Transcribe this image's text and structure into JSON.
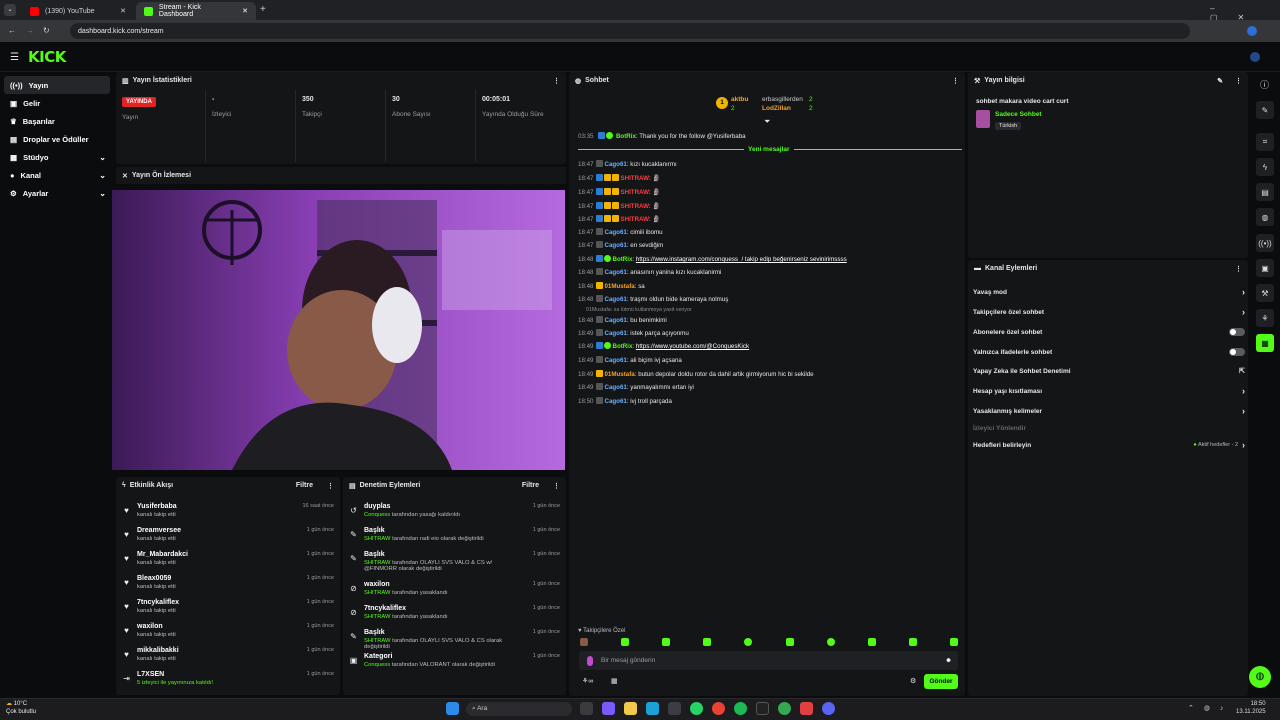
{
  "browser": {
    "tabs": [
      {
        "title": "(1390) YouTube"
      },
      {
        "title": "Stream - Kick Dashboard"
      }
    ],
    "url": "dashboard.kick.com/stream"
  },
  "logo_text": "KICK",
  "sidebar": {
    "items": [
      {
        "label": "Yayın",
        "icon": "broadcast-icon"
      },
      {
        "label": "Gelir",
        "icon": "money-icon"
      },
      {
        "label": "Başarılar",
        "icon": "trophy-icon"
      },
      {
        "label": "Droplar ve Ödüller",
        "icon": "gift-icon"
      },
      {
        "label": "Stüdyo",
        "icon": "studio-icon"
      },
      {
        "label": "Kanal",
        "icon": "user-icon"
      },
      {
        "label": "Ayarlar",
        "icon": "gear-icon"
      }
    ]
  },
  "stats": {
    "title": "Yayın İstatistikleri",
    "live_badge": "YAYINDA",
    "items": [
      {
        "value": "",
        "label": "Yayın"
      },
      {
        "value": "-",
        "label": "İzleyici"
      },
      {
        "value": "350",
        "label": "Takipçi"
      },
      {
        "value": "30",
        "label": "Abone Sayısı"
      },
      {
        "value": "00:05:01",
        "label": "Yayında Olduğu Süre"
      }
    ]
  },
  "preview": {
    "title": "Yayın Ön İzlemesi"
  },
  "activity": {
    "title": "Etkinlik Akışı",
    "filter": "Filtre",
    "rows": [
      {
        "name": "Yusiferbaba",
        "sub": "kanalı takip etti",
        "time": "16 saat önce"
      },
      {
        "name": "Dreamverseе",
        "sub": "kanalı takip etti",
        "time": "1 gün önce"
      },
      {
        "name": "Mr_Mabardakci",
        "sub": "kanalı takip etti",
        "time": "1 gün önce"
      },
      {
        "name": "Bleax0059",
        "sub": "kanalı takip etti",
        "time": "1 gün önce"
      },
      {
        "name": "7tncykaliflex",
        "sub": "kanalı takip etti",
        "time": "1 gün önce"
      },
      {
        "name": "waxilon",
        "sub": "kanalı takip etti",
        "time": "1 gün önce"
      },
      {
        "name": "mikkalibakki",
        "sub": "kanalı takip etti",
        "time": "1 gün önce"
      },
      {
        "name": "L7XSEN",
        "sub": "5 izleyici ile yayınınıza katıldı!",
        "time": "1 gün önce"
      }
    ]
  },
  "moderation": {
    "title": "Denetim Eylemleri",
    "filter": "Filtre",
    "rows": [
      {
        "name": "duyplas",
        "by": "Conquess",
        "sub": " tarafından yasağı kaldırıldı",
        "time": "1 gün önce"
      },
      {
        "name": "Başlık",
        "by": "SHITRAW",
        "sub": " tarafından radi eio olarak değiştirildi",
        "time": "1 gün önce"
      },
      {
        "name": "Başlık",
        "by": "SHITRAW",
        "sub": " tarafından OLAYLI SVS VALO & CS w/ @FINMORR olarak değiştirildi",
        "time": "1 gün önce"
      },
      {
        "name": "waxilon",
        "by": "SHITRAW",
        "sub": " tarafından yasaklandı",
        "time": "1 gün önce"
      },
      {
        "name": "7tncykaliflex",
        "by": "SHITRAW",
        "sub": " tarafından yasaklandı",
        "time": "1 gün önce"
      },
      {
        "name": "Başlık",
        "by": "SHITRAW",
        "sub": " tarafından OLAYLI SVS VALO & CS olarak değiştirildi",
        "time": "1 gün önce"
      },
      {
        "name": "Kategori",
        "by": "Conquess",
        "sub": " tarafından VALORANT olarak değiştirildi",
        "time": "1 gün önce"
      }
    ]
  },
  "chat": {
    "title": "Sohbet",
    "leaderboard": [
      {
        "name": "aktbu",
        "count": "2"
      },
      {
        "name": "erbasgillerden",
        "count": "2"
      },
      {
        "name": "LodZillan",
        "count": "2"
      }
    ],
    "new_messages": "Yeni mesajlar",
    "pinned": {
      "time": "03:35",
      "user": "BotRix",
      "text": "Thank you for the follow @Yusiferbaba"
    },
    "messages": [
      {
        "time": "18:47",
        "user": "Cago61",
        "color": "blue",
        "text": "kızı kucaklanırmı"
      },
      {
        "time": "18:47",
        "user": "SHITRAW",
        "color": "red",
        "text": "🗿"
      },
      {
        "time": "18:47",
        "user": "SHITRAW",
        "color": "red",
        "text": "🗿"
      },
      {
        "time": "18:47",
        "user": "SHITRAW",
        "color": "red",
        "text": "🗿"
      },
      {
        "time": "18:47",
        "user": "SHITRAW",
        "color": "red",
        "text": "🗿"
      },
      {
        "time": "18:47",
        "user": "Cago61",
        "color": "blue",
        "text": "cimili ibomu"
      },
      {
        "time": "18:47",
        "user": "Cago61",
        "color": "blue",
        "text": "en sevdiğim"
      },
      {
        "time": "18:48",
        "user": "BotRix",
        "color": "green",
        "text": "https://www.instagram.com/conquess_/ takip edip beğenirseniz sevinirimssss"
      },
      {
        "time": "18:48",
        "user": "Cago61",
        "color": "blue",
        "text": "anasının yanina kızı kucaklanirmi"
      },
      {
        "time": "18:48",
        "user": "01Mustafa",
        "color": "orange",
        "text": "sa"
      },
      {
        "time": "18:48",
        "user": "Cago61",
        "color": "blue",
        "text": "traşmı oldun bide kameraya nolmuş"
      },
      {
        "time": "18:48",
        "user": "Cago61",
        "color": "blue",
        "text": "bu benimkimi",
        "reply": "01Mustafa: sa lütmü kullanmoya yasit veriyor"
      },
      {
        "time": "18:49",
        "user": "Cago61",
        "color": "blue",
        "text": "istek parça açıyonmu"
      },
      {
        "time": "18:49",
        "user": "BotRix",
        "color": "green",
        "text": "https://www.youtube.com/@ConquesKick"
      },
      {
        "time": "18:49",
        "user": "Cago61",
        "color": "blue",
        "text": "ali biçim ivj açsana"
      },
      {
        "time": "18:49",
        "user": "01Mustafa",
        "color": "orange",
        "text": "butun depolar doldu rotor da dahil artik girmiyorum hic bi sekilde"
      },
      {
        "time": "18:49",
        "user": "Cago61",
        "color": "blue",
        "text": "yanmayalımmı ertan iyi"
      },
      {
        "time": "18:50",
        "user": "Cago61",
        "color": "blue",
        "text": "ivj troll parçada"
      }
    ],
    "mode_label": "Takipçilere Özel",
    "input_placeholder": "Bir mesaj gönderin",
    "send": "Gönder"
  },
  "stream_info": {
    "title": "Yayın bilgisi",
    "stream_title": "sohbet makara video cart curt",
    "category": "Sadece Sohbet",
    "language": "Türkish"
  },
  "channel_actions": {
    "title": "Kanal Eylemleri",
    "items": [
      {
        "label": "Yavaş mod",
        "control": "chevron"
      },
      {
        "label": "Takipçilere özel sohbet",
        "control": "chevron"
      },
      {
        "label": "Abonelere özel sohbet",
        "control": "toggle"
      },
      {
        "label": "Yalnızca ifadelerle sohbet",
        "control": "toggle"
      },
      {
        "label": "Yapay Zeka ile Sohbet Denetimi",
        "control": "external"
      },
      {
        "label": "Hesap yaşı kısıtlaması",
        "control": "chevron"
      },
      {
        "label": "Yasaklanmış kelimeler",
        "control": "chevron"
      }
    ],
    "section": "İzleyici Yönlendir",
    "goals_label": "Hedefleri belirleyin",
    "goals_status": "Aktif hedefler - 2"
  },
  "taskbar": {
    "weather_temp": "10°C",
    "weather_text": "Çok bulutlu",
    "search": "Ara",
    "time": "18:50",
    "date": "13.11.2025"
  },
  "colors": {
    "accent": "#53fc18",
    "live": "#e02424"
  }
}
